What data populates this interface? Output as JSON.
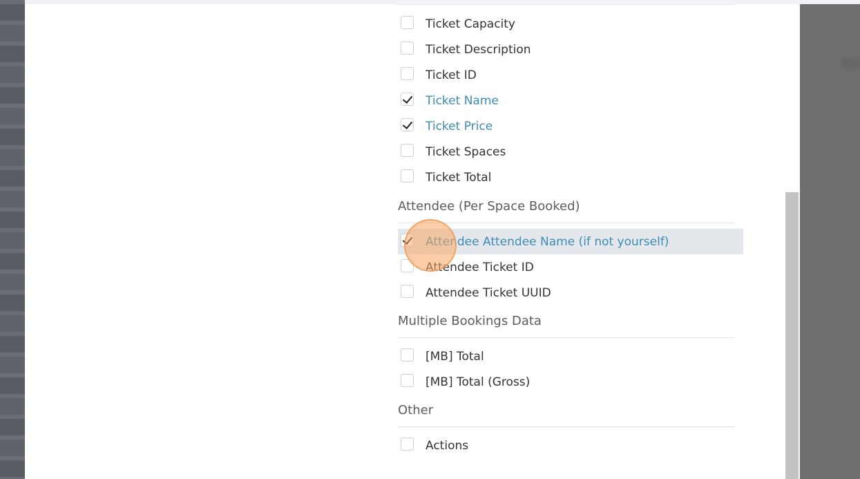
{
  "groups": {
    "ticket": {
      "items": [
        {
          "label": "Ticket Capacity",
          "checked": false
        },
        {
          "label": "Ticket Description",
          "checked": false
        },
        {
          "label": "Ticket ID",
          "checked": false
        },
        {
          "label": "Ticket Name",
          "checked": true
        },
        {
          "label": "Ticket Price",
          "checked": true
        },
        {
          "label": "Ticket Spaces",
          "checked": false
        },
        {
          "label": "Ticket Total",
          "checked": false
        }
      ]
    },
    "attendee": {
      "heading": "Attendee (Per Space Booked)",
      "items": [
        {
          "label": "Attendee Attendee Name (if not yourself)",
          "checked": true
        },
        {
          "label": "Attendee Ticket ID",
          "checked": false
        },
        {
          "label": "Attendee Ticket UUID",
          "checked": false
        }
      ]
    },
    "multiple": {
      "heading": "Multiple Bookings Data",
      "items": [
        {
          "label": "[MB] Total",
          "checked": false
        },
        {
          "label": "[MB] Total (Gross)",
          "checked": false
        }
      ]
    },
    "other": {
      "heading": "Other",
      "items": [
        {
          "label": "Actions",
          "checked": false
        }
      ]
    }
  },
  "colors": {
    "checked_label": "#3d8bb5",
    "highlight_row": "#e4e8ec",
    "click_marker": "#f7a562"
  }
}
